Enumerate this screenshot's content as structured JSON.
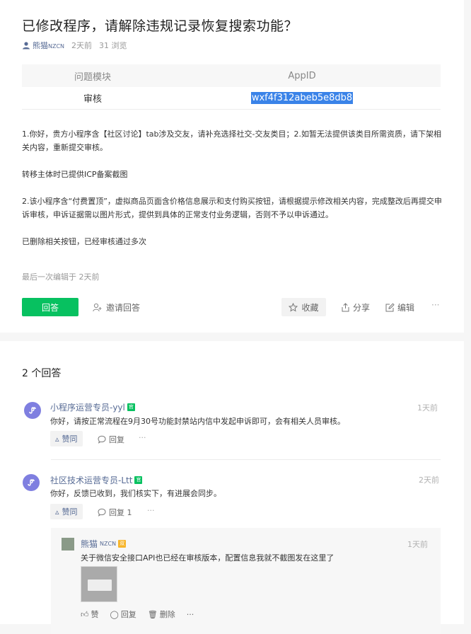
{
  "question": {
    "title": "已修改程序，请解除违规记录恢复搜索功能？",
    "author": "熊猫",
    "author_suffix": "NZCN",
    "posted": "2天前",
    "views": "31 浏览",
    "table": {
      "headers": [
        "问题模块",
        "AppID"
      ],
      "rows": [
        [
          "审核",
          "wxf4f312abeb5e8db8"
        ]
      ]
    },
    "body": [
      "1.你好，贵方小程序含【社区讨论】tab涉及交友，请补充选择社交-交友类目；2.如暂无法提供该类目所需资质，请下架相关内容，重新提交审核。",
      "转移主体时已提供ICP备案截图",
      "2.该小程序含“付费置顶”，虚拟商品页面含价格信息展示和支付购买按钮，请根据提示修改相关内容，完成整改后再提交申诉审核，申诉证据需以图片形式，提供到具体的正常支付业务逻辑，否则不予以申诉通过。",
      "已删除相关按钮，已经审核通过多次"
    ],
    "edited": "最后一次编辑于  2天前",
    "actions": {
      "answer": "回答",
      "invite": "邀请回答",
      "favorite": "收藏",
      "share": "分享",
      "edit": "编辑",
      "more": "···"
    }
  },
  "answers_header": "2 个回答",
  "answers": [
    {
      "name": "小程序运营专员-yyl",
      "badge": "官",
      "time": "1天前",
      "text": "你好，请按正常流程在9月30号功能封禁站内信中发起申诉即可，会有相关人员审核。",
      "like": "赞同",
      "reply": "回复",
      "more": "···"
    },
    {
      "name": "社区技术运营专员-Ltt",
      "badge": "官",
      "time": "2天前",
      "text": "你好，反馈已收到，我们核实下，有进展会同步。",
      "like": "赞同",
      "reply": "回复 1",
      "more": "···"
    }
  ],
  "sub_reply": {
    "name": "熊猫",
    "name_suffix": "NZCN",
    "badge": "双",
    "time": "1天前",
    "text": "关于微信安全接口API也已经在审核版本，配置信息我就不截图发在这里了",
    "like": "赞",
    "reply": "回复",
    "delete": "删除",
    "more": "···"
  },
  "colors": {
    "accent": "#07c160",
    "link": "#576b95",
    "selection": "#3a83e8"
  }
}
